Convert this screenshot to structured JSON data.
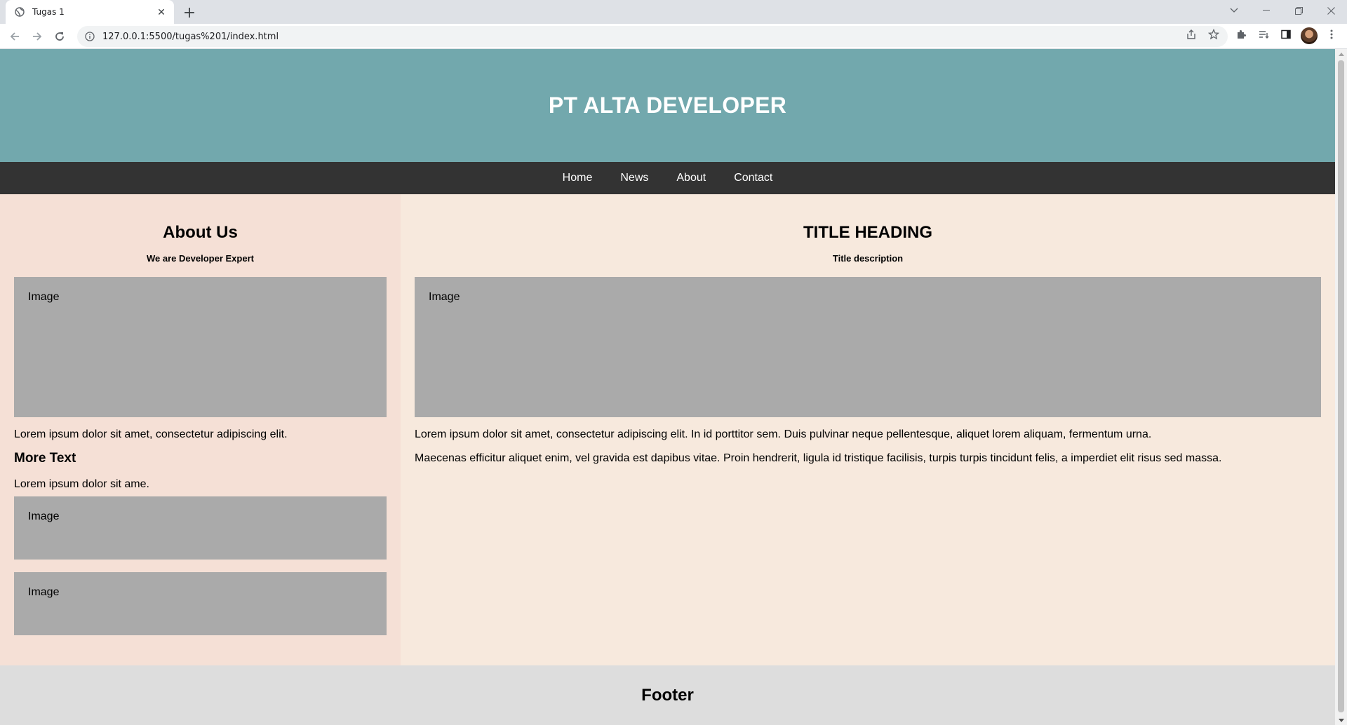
{
  "browser": {
    "tab_title": "Tugas 1",
    "url": "127.0.0.1:5500/tugas%201/index.html"
  },
  "site": {
    "title": "PT ALTA DEVELOPER",
    "nav": [
      "Home",
      "News",
      "About",
      "Contact"
    ],
    "left": {
      "heading": "About Us",
      "subheading": "We are Developer Expert",
      "image_label": "Image",
      "paragraph": "Lorem ipsum dolor sit amet, consectetur adipiscing elit.",
      "more_heading": "More Text",
      "more_paragraph": "Lorem ipsum dolor sit ame.",
      "image2_label": "Image",
      "image3_label": "Image"
    },
    "right": {
      "heading": "TITLE HEADING",
      "subheading": "Title description",
      "image_label": "Image",
      "paragraph1": "Lorem ipsum dolor sit amet, consectetur adipiscing elit. In id porttitor sem. Duis pulvinar neque pellentesque, aliquet lorem aliquam, fermentum urna.",
      "paragraph2": "Maecenas efficitur aliquet enim, vel gravida est dapibus vitae. Proin hendrerit, ligula id tristique facilisis, turpis turpis tincidunt felis, a imperdiet elit risus sed massa."
    },
    "footer": "Footer"
  },
  "colors": {
    "header_bg": "#72a8ad",
    "nav_bg": "#333333",
    "left_bg": "#f5e0d6",
    "right_bg": "#f7e9dd",
    "image_bg": "#aaaaaa",
    "footer_bg": "#dddddd"
  }
}
